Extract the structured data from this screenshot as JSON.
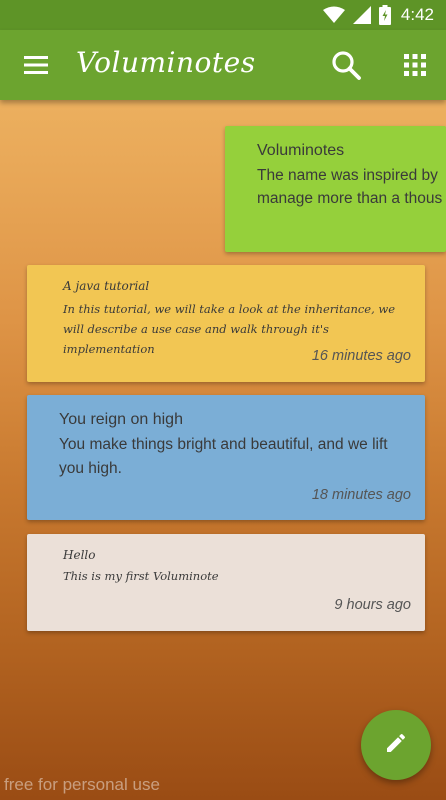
{
  "status_bar": {
    "time": "4:42",
    "icons": [
      "wifi-icon",
      "signal-icon",
      "battery-icon"
    ]
  },
  "toolbar": {
    "title": "Voluminotes",
    "icons": [
      "menu-icon",
      "search-icon",
      "grid-view-icon"
    ]
  },
  "notes": [
    {
      "title": "Voluminotes",
      "body": "The name was inspired by manage more than a thous",
      "body_lines": [
        "The name was inspired by",
        "manage more than a thous"
      ],
      "color": "#95d03b",
      "time": ""
    },
    {
      "title": "A java tutorial",
      "body": "In this tutorial, we will take a look at the inheritance, we will describe a use case and walk through it's implementation",
      "color": "#f2c653",
      "time": "16 minutes ago"
    },
    {
      "title": "You reign on high",
      "body": "You make things bright and beautiful, and we lift you high.",
      "color": "#7baed6",
      "time": "18 minutes ago"
    },
    {
      "title": "Hello",
      "body": "This is my first Voluminote",
      "color": "#ebe0d8",
      "time": "9 hours ago"
    }
  ],
  "fab": {
    "icon": "edit-pencil-icon"
  },
  "watermark": "free for personal use",
  "colors": {
    "status_bar": "#5e9427",
    "toolbar": "#6ca42f",
    "fab": "#6ca42f"
  }
}
